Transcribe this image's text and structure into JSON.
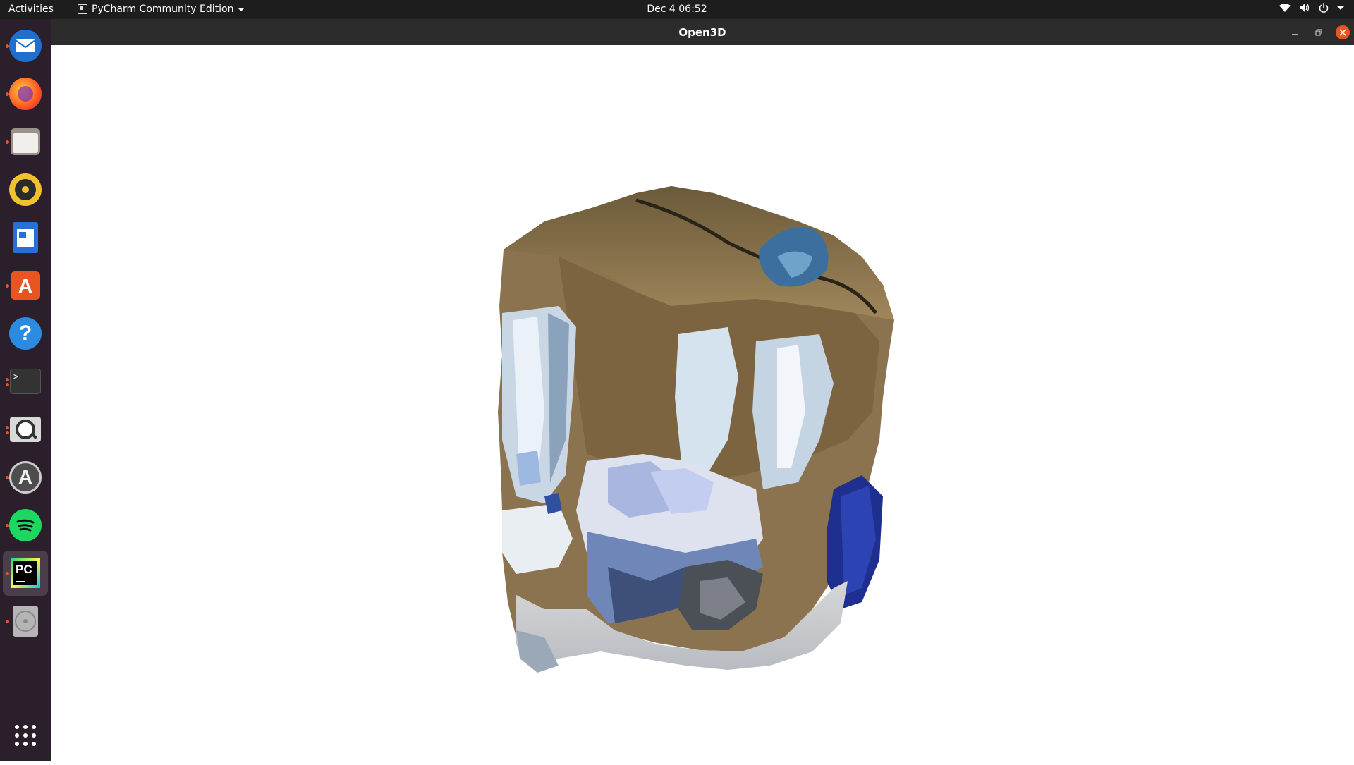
{
  "topbar": {
    "activities": "Activities",
    "app_name": "PyCharm Community Edition",
    "clock": "Dec 4  06:52"
  },
  "dock": {
    "items": [
      {
        "name": "thunderbird",
        "icon": "thunderbird-icon",
        "running": true
      },
      {
        "name": "firefox",
        "icon": "firefox-icon",
        "running": true
      },
      {
        "name": "files",
        "icon": "files-icon",
        "running": true
      },
      {
        "name": "rhythmbox",
        "icon": "rhythmbox-icon",
        "running": false
      },
      {
        "name": "libreoffice-writer",
        "icon": "writer-icon",
        "running": false
      },
      {
        "name": "ubuntu-software",
        "icon": "software-center-icon",
        "running": true
      },
      {
        "name": "help",
        "icon": "help-icon",
        "running": false
      },
      {
        "name": "terminal",
        "icon": "terminal-icon",
        "running": true
      },
      {
        "name": "image-viewer",
        "icon": "magnifier-icon",
        "running": true
      },
      {
        "name": "software-updater",
        "icon": "updater-icon",
        "running": true
      },
      {
        "name": "spotify",
        "icon": "spotify-icon",
        "running": true
      },
      {
        "name": "pycharm",
        "icon": "pycharm-icon",
        "running": true,
        "active": true
      },
      {
        "name": "disc",
        "icon": "disc-icon",
        "running": true
      }
    ],
    "show_apps_icon": "grid-icon"
  },
  "window": {
    "title": "Open3D",
    "controls": [
      "minimize",
      "restore",
      "close"
    ]
  },
  "viewer": {
    "content": "3D point cloud scene",
    "colors": {
      "background": "#ffffff"
    }
  }
}
